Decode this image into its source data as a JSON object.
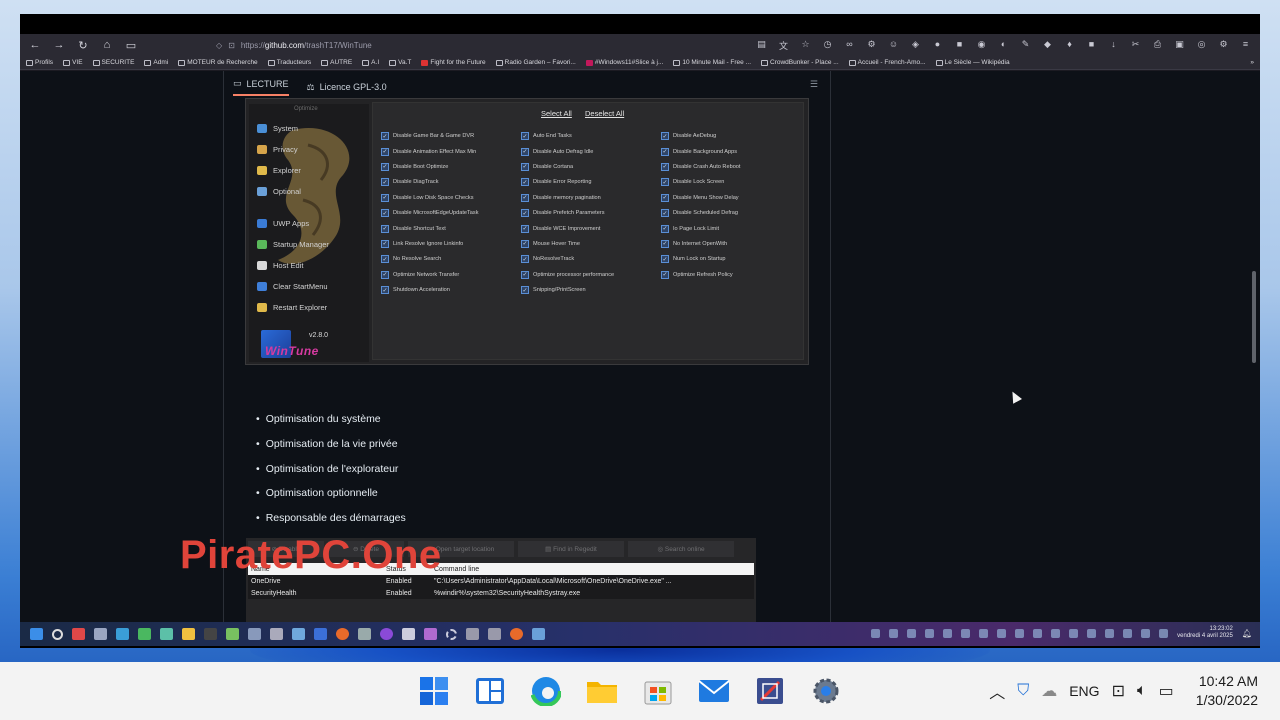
{
  "browser": {
    "url_prefix": "https://",
    "url_domain": "github.com",
    "url_path": "/trashT17/WinTune",
    "bookmarks": [
      "Profils",
      "VIE",
      "SECURITE",
      "Admi",
      "MOTEUR de Recherche",
      "Traducteurs",
      "AUTRE",
      "A.I",
      "Va.T",
      "Fight for the Future",
      "Radio Garden – Favori...",
      "#Windows11#Slice à j...",
      "10 Minute Mail - Free ...",
      "CrowdBunker - Place ...",
      "Accueil - French-Amo...",
      "Le Siècle — Wikipédia"
    ]
  },
  "readme": {
    "tab_reading": "LECTURE",
    "tab_license": "Licence GPL-3.0"
  },
  "app": {
    "optimize_label": "Optimize",
    "version": "v2.8.0",
    "logo_text": "WinTune",
    "select_all": "Select All",
    "deselect_all": "Deselect All",
    "sidebar": [
      "System",
      "Privacy",
      "Explorer",
      "Optional",
      "UWP Apps",
      "Startup Manager",
      "Host Edit",
      "Clear StartMenu",
      "Restart Explorer"
    ],
    "options": [
      "Disable Game Bar & Game DVR",
      "Auto End Tasks",
      "Disable AeDebug",
      "Disable Animation Effect Max Min",
      "Disable Auto Defrag Idle",
      "Disable Background Apps",
      "Disable Boot Optimize",
      "Disable Cortana",
      "Disable Crash Auto Reboot",
      "Disable DiagTrack",
      "Disable Error Reporting",
      "Disable Lock Screen",
      "Disable Low Disk Space Checks",
      "Disable memory pagination",
      "Disable Menu Show Delay",
      "Disable MicrosoftEdgeUpdateTask",
      "Disable Prefetch Parameters",
      "Disable Scheduled Defrag",
      "Disable Shortcut Text",
      "Disable WCE Improvement",
      "Io Page Lock Limit",
      "Link Resolve Ignore Linkinfo",
      "Mouse Hover Time",
      "No Internet OpenWith",
      "No Resolve Search",
      "NoResolveTrack",
      "Num Lock on Startup",
      "Optimize Network Transfer",
      "Optimize processor performance",
      "Optimize Refresh Policy",
      "Shutdown Acceleration",
      "Snipping/PrintScreen",
      ""
    ]
  },
  "bullets": [
    "Optimisation du système",
    "Optimisation de la vie privée",
    "Optimisation de l'explorateur",
    "Optimisation optionnelle",
    "Responsable des démarrages"
  ],
  "startup_manager": {
    "buttons": [
      "Disable",
      "Delete",
      "Open target location",
      "Find in Regedit",
      "Search online"
    ],
    "headers": [
      "Name",
      "Status",
      "Command line"
    ],
    "rows": [
      {
        "name": "OneDrive",
        "status": "Enabled",
        "cmd": "\"C:\\Users\\Administrator\\AppData\\Local\\Microsoft\\OneDrive\\OneDrive.exe\" ..."
      },
      {
        "name": "SecurityHealth",
        "status": "Enabled",
        "cmd": "%windir%\\system32\\SecurityHealthSystray.exe"
      }
    ]
  },
  "watermark": "PiratePC.One",
  "inner_clock": {
    "time": "13:23:02",
    "date": "vendredi 4 avril 2025"
  },
  "taskbar": {
    "language": "ENG",
    "time": "10:42 AM",
    "date": "1/30/2022"
  }
}
